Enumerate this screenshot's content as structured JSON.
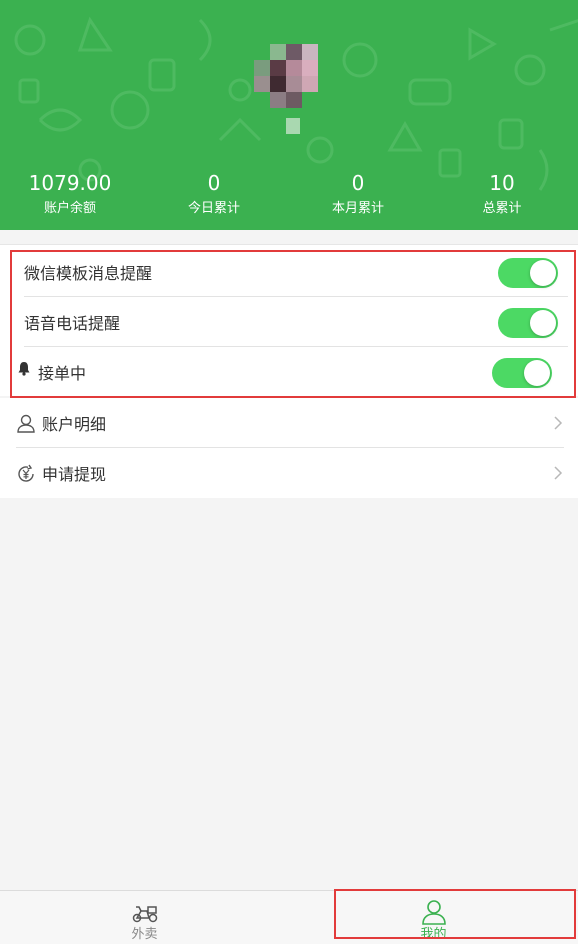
{
  "header": {
    "stats": [
      {
        "value": "1079.00",
        "label": "账户余额"
      },
      {
        "value": "0",
        "label": "今日累计"
      },
      {
        "value": "0",
        "label": "本月累计"
      },
      {
        "value": "10",
        "label": "总累计"
      }
    ]
  },
  "settings": {
    "rows": [
      {
        "label": "微信模板消息提醒",
        "enabled": true
      },
      {
        "label": "语音电话提醒",
        "enabled": true
      },
      {
        "label": "接单中",
        "enabled": true,
        "icon": "bell-icon"
      }
    ]
  },
  "menu": {
    "items": [
      {
        "label": "账户明细",
        "icon": "user-icon"
      },
      {
        "label": "申请提现",
        "icon": "yen-withdraw-icon"
      }
    ]
  },
  "tabbar": {
    "tabs": [
      {
        "label": "外卖",
        "icon": "scooter-icon",
        "active": false
      },
      {
        "label": "我的",
        "icon": "user-icon",
        "active": true
      }
    ]
  },
  "colors": {
    "header_green": "#3bb150",
    "toggle_on": "#4cd964",
    "active_tab": "#3bb150",
    "highlight_red": "#e23b3b"
  }
}
